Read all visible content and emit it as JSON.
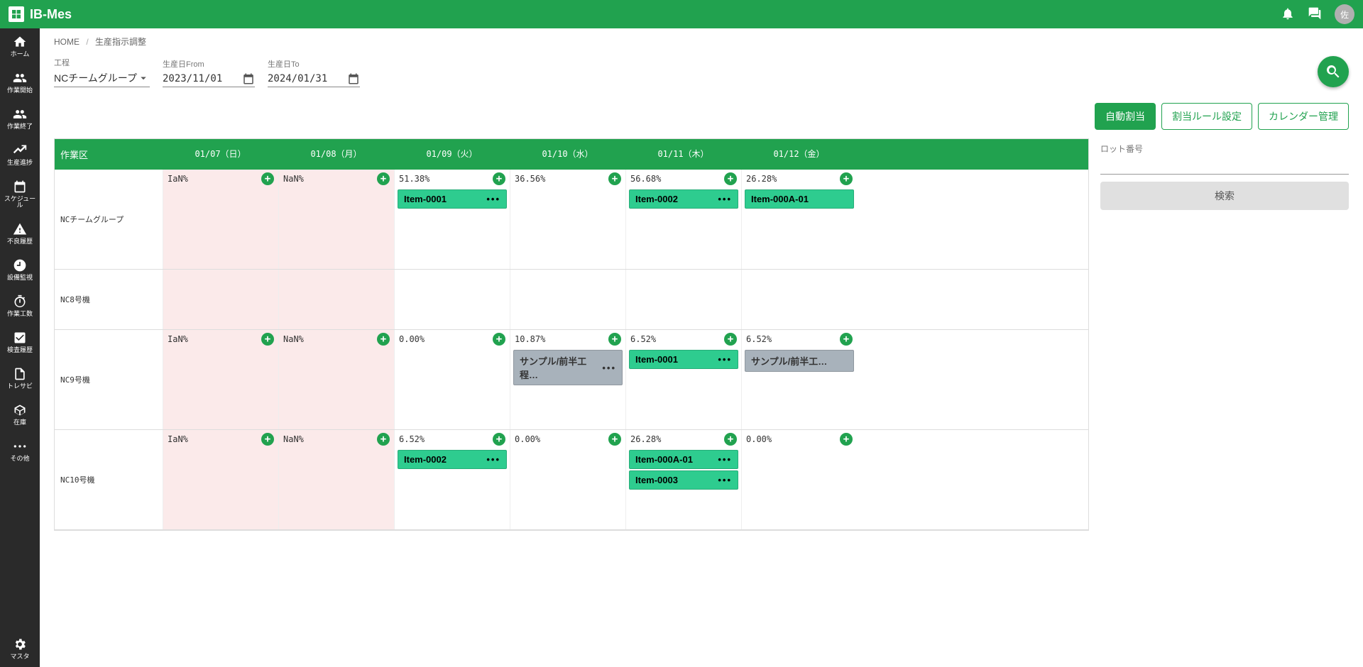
{
  "app_name": "IB-Mes",
  "avatar_text": "佐",
  "breadcrumb": {
    "home": "HOME",
    "current": "生産指示調整"
  },
  "filters": {
    "process_label": "工程",
    "process_value": "NCチームグループ",
    "date_from_label": "生産日From",
    "date_from_value": "2023/11/01",
    "date_to_label": "生産日To",
    "date_to_value": "2024/01/31"
  },
  "actions": {
    "auto_assign": "自動割当",
    "rule_setting": "割当ルール設定",
    "calendar_manage": "カレンダー管理"
  },
  "sidebar": [
    {
      "label": "ホーム",
      "icon": "home"
    },
    {
      "label": "作業開始",
      "icon": "group"
    },
    {
      "label": "作業終了",
      "icon": "group"
    },
    {
      "label": "生産進捗",
      "icon": "trend"
    },
    {
      "label": "スケジュール",
      "icon": "calendar"
    },
    {
      "label": "不良履歴",
      "icon": "warn"
    },
    {
      "label": "設備監視",
      "icon": "clock"
    },
    {
      "label": "作業工数",
      "icon": "timer"
    },
    {
      "label": "検査履歴",
      "icon": "check"
    },
    {
      "label": "トレサビ",
      "icon": "doc"
    },
    {
      "label": "在庫",
      "icon": "box"
    },
    {
      "label": "その他",
      "icon": "more"
    }
  ],
  "sidebar_bottom": {
    "label": "マスタ",
    "icon": "gear"
  },
  "schedule": {
    "work_area_label": "作業区",
    "days": [
      {
        "label": "01/07（日）",
        "off": true
      },
      {
        "label": "01/08（月）",
        "off": true
      },
      {
        "label": "01/09（火）",
        "off": false
      },
      {
        "label": "01/10（水）",
        "off": false
      },
      {
        "label": "01/11（木）",
        "off": false
      },
      {
        "label": "01/12（金）",
        "off": false
      }
    ],
    "rows": [
      {
        "name": "NCチームグループ",
        "height": "tall",
        "cells": [
          {
            "pct": "IaN%",
            "add": true,
            "off": true,
            "items": []
          },
          {
            "pct": "NaN%",
            "add": true,
            "off": true,
            "items": []
          },
          {
            "pct": "51.38%",
            "add": true,
            "off": false,
            "items": [
              {
                "label": "Item-0001",
                "style": "green",
                "dots": true
              }
            ]
          },
          {
            "pct": "36.56%",
            "add": true,
            "off": false,
            "items": []
          },
          {
            "pct": "56.68%",
            "add": true,
            "off": false,
            "items": [
              {
                "label": "Item-0002",
                "style": "green",
                "dots": true
              }
            ]
          },
          {
            "pct": "26.28%",
            "add": true,
            "off": false,
            "items": [
              {
                "label": "Item-000A-01",
                "style": "green",
                "dots": false
              }
            ]
          }
        ]
      },
      {
        "name": "NC8号機",
        "height": "med",
        "cells": [
          {
            "pct": "",
            "add": false,
            "off": true,
            "items": []
          },
          {
            "pct": "",
            "add": false,
            "off": true,
            "items": []
          },
          {
            "pct": "",
            "add": false,
            "off": false,
            "items": []
          },
          {
            "pct": "",
            "add": false,
            "off": false,
            "items": []
          },
          {
            "pct": "",
            "add": false,
            "off": false,
            "items": []
          },
          {
            "pct": "",
            "add": false,
            "off": false,
            "items": []
          }
        ]
      },
      {
        "name": "NC9号機",
        "height": "tall",
        "cells": [
          {
            "pct": "IaN%",
            "add": true,
            "off": true,
            "items": []
          },
          {
            "pct": "NaN%",
            "add": true,
            "off": true,
            "items": []
          },
          {
            "pct": "0.00%",
            "add": true,
            "off": false,
            "items": []
          },
          {
            "pct": "10.87%",
            "add": true,
            "off": false,
            "items": [
              {
                "label": "サンプル/前半工程…",
                "style": "gray",
                "dots": true
              }
            ]
          },
          {
            "pct": "6.52%",
            "add": true,
            "off": false,
            "items": [
              {
                "label": "Item-0001",
                "style": "green",
                "dots": true
              }
            ]
          },
          {
            "pct": "6.52%",
            "add": true,
            "off": false,
            "items": [
              {
                "label": "サンプル/前半工…",
                "style": "gray",
                "dots": false
              }
            ]
          }
        ]
      },
      {
        "name": "NC10号機",
        "height": "tall",
        "cells": [
          {
            "pct": "IaN%",
            "add": true,
            "off": true,
            "items": []
          },
          {
            "pct": "NaN%",
            "add": true,
            "off": true,
            "items": []
          },
          {
            "pct": "6.52%",
            "add": true,
            "off": false,
            "items": [
              {
                "label": "Item-0002",
                "style": "green",
                "dots": true
              }
            ]
          },
          {
            "pct": "0.00%",
            "add": true,
            "off": false,
            "items": []
          },
          {
            "pct": "26.28%",
            "add": true,
            "off": false,
            "items": [
              {
                "label": "Item-000A-01",
                "style": "green",
                "dots": true
              },
              {
                "label": "Item-0003",
                "style": "green",
                "dots": true
              }
            ]
          },
          {
            "pct": "0.00%",
            "add": true,
            "off": false,
            "items": []
          }
        ]
      }
    ]
  },
  "side_panel": {
    "lot_label": "ロット番号",
    "search_label": "検索"
  }
}
